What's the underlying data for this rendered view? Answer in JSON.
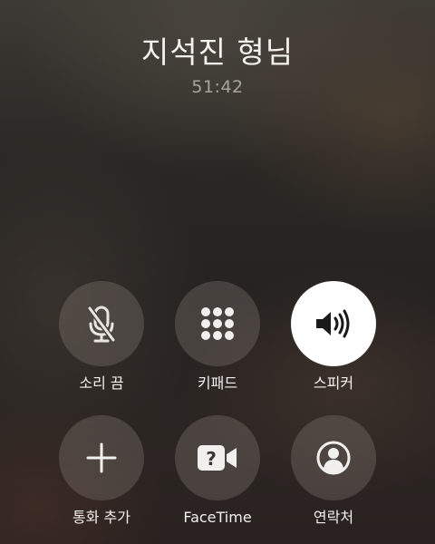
{
  "call": {
    "caller_name": "지석진 형님",
    "timer": "51:42"
  },
  "controls": [
    {
      "label": "소리 끔",
      "icon": "mic-slash-icon",
      "active": false
    },
    {
      "label": "키패드",
      "icon": "keypad-icon",
      "active": false
    },
    {
      "label": "스피커",
      "icon": "speaker-icon",
      "active": true
    },
    {
      "label": "통화 추가",
      "icon": "plus-icon",
      "active": false
    },
    {
      "label": "FaceTime",
      "icon": "facetime-icon",
      "active": false
    },
    {
      "label": "연락처",
      "icon": "contact-icon",
      "active": false
    }
  ],
  "colors": {
    "active_button": "#ffffff",
    "inactive_button": "rgba(140,130,125,0.32)",
    "icon_dark": "#1a1a1a"
  }
}
